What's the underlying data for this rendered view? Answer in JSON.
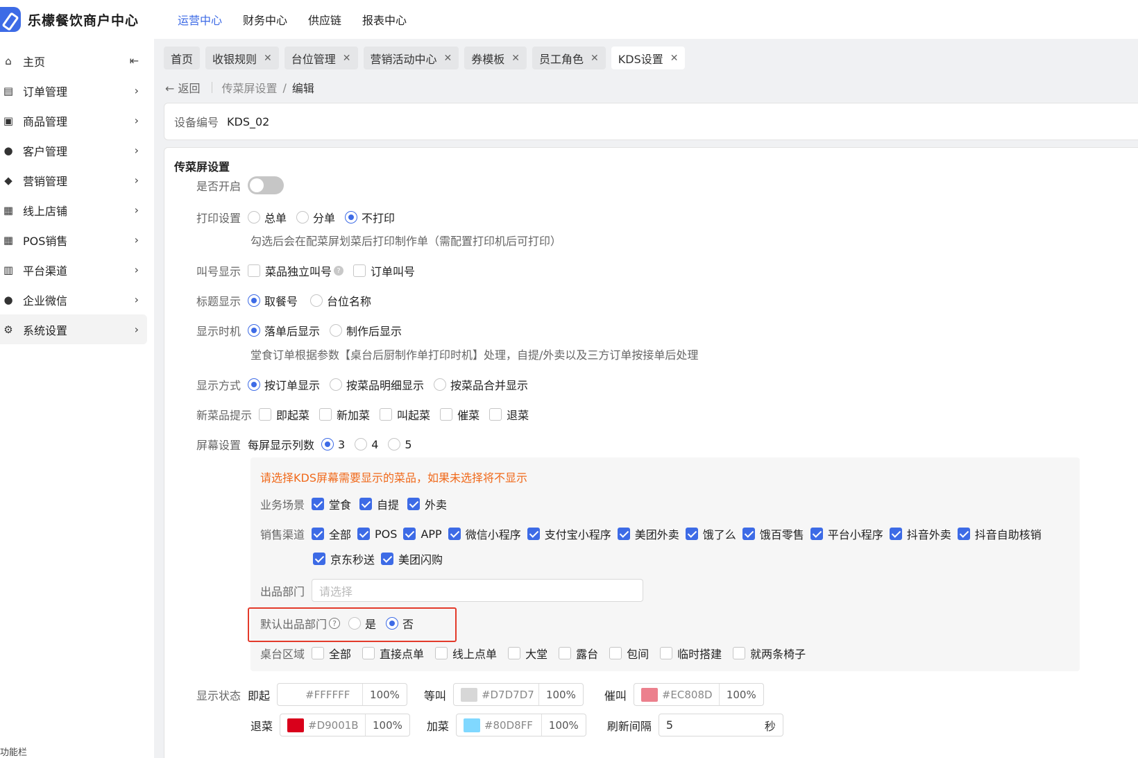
{
  "app": {
    "title": "乐檬餐饮商户中心"
  },
  "topnav": [
    "运营中心",
    "财务中心",
    "供应链",
    "报表中心"
  ],
  "sidebar": {
    "items": [
      {
        "label": "主页",
        "icon": "home-icon"
      },
      {
        "label": "订单管理",
        "icon": "order-icon"
      },
      {
        "label": "商品管理",
        "icon": "product-icon"
      },
      {
        "label": "客户管理",
        "icon": "user-icon"
      },
      {
        "label": "营销管理",
        "icon": "tag-icon"
      },
      {
        "label": "线上店铺",
        "icon": "store-icon"
      },
      {
        "label": "POS销售",
        "icon": "pos-store-icon"
      },
      {
        "label": "平台渠道",
        "icon": "bank-icon"
      },
      {
        "label": "企业微信",
        "icon": "chat-icon"
      },
      {
        "label": "系统设置",
        "icon": "gear-icon"
      }
    ],
    "footer": "功能栏"
  },
  "tabs": [
    "首页",
    "收银规则",
    "台位管理",
    "营销活动中心",
    "券模板",
    "员工角色",
    "KDS设置"
  ],
  "breadcrumb": {
    "back": "返回",
    "parent": "传菜屏设置",
    "sep": "/",
    "current": "编辑"
  },
  "device": {
    "label": "设备编号",
    "value": "KDS_02"
  },
  "form": {
    "section_title": "传菜屏设置",
    "enable": {
      "label": "是否开启"
    },
    "print": {
      "label": "打印设置",
      "options": [
        "总单",
        "分单",
        "不打印"
      ],
      "hint": "勾选后会在配菜屏划菜后打印制作单（需配置打印机后可打印）"
    },
    "call": {
      "label": "叫号显示",
      "options": [
        "菜品独立叫号",
        "订单叫号"
      ]
    },
    "title": {
      "label": "标题显示",
      "options": [
        "取餐号",
        "台位名称"
      ]
    },
    "timing": {
      "label": "显示时机",
      "options": [
        "落单后显示",
        "制作后显示"
      ],
      "hint": "堂食订单根据参数【桌台后厨制作单打印时机】处理，自提/外卖以及三方订单按接单后处理"
    },
    "mode": {
      "label": "显示方式",
      "options": [
        "按订单显示",
        "按菜品明细显示",
        "按菜品合并显示"
      ]
    },
    "newdish": {
      "label": "新菜品提示",
      "options": [
        "即起菜",
        "新加菜",
        "叫起菜",
        "催菜",
        "退菜"
      ]
    },
    "screen": {
      "label": "屏幕设置",
      "cols_label": "每屏显示列数",
      "options": [
        "3",
        "4",
        "5"
      ]
    },
    "panel": {
      "warning": "请选择KDS屏幕需要显示的菜品，如果未选择将不显示",
      "scene": {
        "label": "业务场景",
        "options": [
          "堂食",
          "自提",
          "外卖"
        ]
      },
      "channel": {
        "label": "销售渠道",
        "row1": [
          "全部",
          "POS",
          "APP",
          "微信小程序",
          "支付宝小程序",
          "美团外卖",
          "饿了么",
          "饿百零售",
          "平台小程序",
          "抖音外卖",
          "抖音自助核销"
        ],
        "row2": [
          "京东秒送",
          "美团闪购"
        ]
      },
      "dept": {
        "label": "出品部门",
        "placeholder": "请选择"
      },
      "default_dept": {
        "label": "默认出品部门",
        "options": [
          "是",
          "否"
        ]
      },
      "area": {
        "label": "桌台区域",
        "options": [
          "全部",
          "直接点单",
          "线上点单",
          "大堂",
          "露台",
          "包间",
          "临时搭建",
          "就两条椅子"
        ]
      }
    },
    "status": {
      "label": "显示状态",
      "items": [
        {
          "name": "即起",
          "hex": "#FFFFFF",
          "pct": "100%"
        },
        {
          "name": "等叫",
          "hex": "#D7D7D7",
          "pct": "100%"
        },
        {
          "name": "催叫",
          "hex": "#EC808D",
          "pct": "100%"
        }
      ],
      "row2": [
        {
          "name": "退菜",
          "hex": "#D9001B",
          "pct": "100%"
        },
        {
          "name": "加菜",
          "hex": "#80D8FF",
          "pct": "100%"
        }
      ],
      "refresh_label": "刷新间隔",
      "refresh_value": "5",
      "refresh_unit": "秒"
    }
  },
  "colors": {
    "accent": "#3d6be6",
    "warning": "#f0691b",
    "highlight_box": "#e33a2a"
  }
}
